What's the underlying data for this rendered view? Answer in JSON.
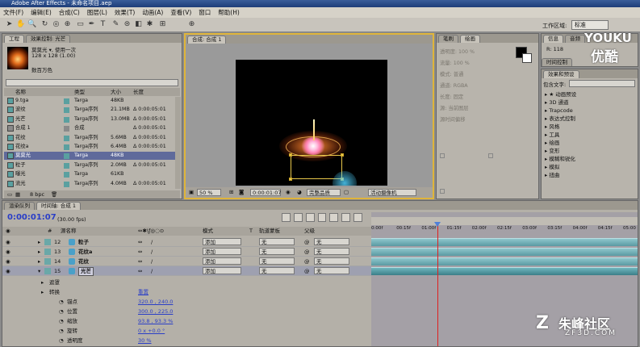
{
  "app": {
    "title": "Adobe After Effects - 未命名项目.aep"
  },
  "menu": [
    "文件(F)",
    "编辑(E)",
    "合成(C)",
    "图层(L)",
    "效果(T)",
    "动画(A)",
    "查看(V)",
    "窗口",
    "帮助(H)"
  ],
  "toolbar": {
    "workspace_label": "工作区域:",
    "workspace_value": "标准"
  },
  "project": {
    "tabs": [
      "工程",
      "效果控制: 光芒"
    ],
    "selected_name": "莫莫光 ▾, 使用一次",
    "selected_size": "128 x 128 (1.00)",
    "selected_color": "数百万色",
    "search_placeholder": "",
    "columns": [
      "名称",
      "类型",
      "大小",
      "长度"
    ],
    "items": [
      {
        "name": "9.tga",
        "type": "Targa",
        "size": "48KB",
        "length": "",
        "color": "#5aa0a0"
      },
      {
        "name": "波纹",
        "type": "Targa序列",
        "size": "21.1MB",
        "length": "Δ 0:00:05:01",
        "color": "#5aa0a0"
      },
      {
        "name": "光芒",
        "type": "Targa序列",
        "size": "13.0MB",
        "length": "Δ 0:00:05:01",
        "color": "#5aa0a0"
      },
      {
        "name": "合成 1",
        "type": "合成",
        "size": "",
        "length": "Δ 0:00:05:01",
        "color": "#8a8a8a"
      },
      {
        "name": "花纹",
        "type": "Targa序列",
        "size": "5.6MB",
        "length": "Δ 0:00:05:01",
        "color": "#5aa0a0"
      },
      {
        "name": "花纹a",
        "type": "Targa序列",
        "size": "6.4MB",
        "length": "Δ 0:00:05:01",
        "color": "#5aa0a0"
      },
      {
        "name": "莫莫光",
        "type": "Targa",
        "size": "48KB",
        "length": "",
        "color": "#5aa0a0",
        "selected": true
      },
      {
        "name": "粒子",
        "type": "Targa序列",
        "size": "2.0MB",
        "length": "Δ 0:00:05:01",
        "color": "#5aa0a0"
      },
      {
        "name": "曝光",
        "type": "Targa",
        "size": "61KB",
        "length": "",
        "color": "#5aa0a0"
      },
      {
        "name": "流光",
        "type": "Targa序列",
        "size": "4.0MB",
        "length": "Δ 0:00:05:01",
        "color": "#5aa0a0"
      }
    ],
    "bpc": "8 bpc"
  },
  "composition": {
    "tab": "合成: 合成 1",
    "zoom": "50 %",
    "timecode": "0:00:01:07",
    "quality": "完整品质",
    "camera": "活动摄像机"
  },
  "info_panels": {
    "tabs_left": [
      "笔刷",
      "绘画"
    ],
    "tabs_right": [
      "信息",
      "音频"
    ],
    "paint_rows": [
      "透明度: 100 %",
      "流量: 100 %",
      "模式: 普通",
      "通道: RGBA",
      "长度: 固定",
      "源: 当前图层",
      "源时间偏移"
    ],
    "info_value": "R: 118",
    "time_control_tab": "时间控制"
  },
  "effects": {
    "tab": "效果和预设",
    "search_label": "包含文字:",
    "items": [
      "▸ ★ 动画预设",
      "▸ 3D 通道",
      "▸ Trapcode",
      "▸ 表达式控制",
      "▸ 风格",
      "▸ 工具",
      "▸ 绘画",
      "▸ 变形",
      "▸ 模糊和锐化",
      "▸ 模拟",
      "▸ 扭曲"
    ]
  },
  "timeline": {
    "tabs": [
      "渲染队列",
      "时间轴: 合成 1"
    ],
    "current_time": "0:00:01:07",
    "fps": "(30.00 fps)",
    "columns": {
      "num": "#",
      "source": "源名称",
      "switches": "模式",
      "t": "T",
      "trkmat": "轨道蒙板",
      "parent": "父级"
    },
    "layers": [
      {
        "num": "12",
        "name": "粒子",
        "mode": "添加",
        "trkmat": "无",
        "parent": "无"
      },
      {
        "num": "13",
        "name": "花纹a",
        "mode": "添加",
        "trkmat": "无",
        "parent": "无"
      },
      {
        "num": "14",
        "name": "花纹",
        "mode": "添加",
        "trkmat": "无",
        "parent": "无"
      },
      {
        "num": "15",
        "name": "光芒",
        "mode": "添加",
        "trkmat": "无",
        "parent": "无"
      }
    ],
    "props": [
      {
        "label": "遮罩",
        "value": "",
        "indent": 1
      },
      {
        "label": "转换",
        "value": "重置",
        "indent": 1
      },
      {
        "label": "锚点",
        "value": "320.0 , 240.0",
        "indent": 2
      },
      {
        "label": "位置",
        "value": "300.0 , 225.0",
        "indent": 2
      },
      {
        "label": "缩放",
        "value": "93.8 , 93.3 %",
        "indent": 2
      },
      {
        "label": "旋转",
        "value": "0 x +0.0 °",
        "indent": 2
      },
      {
        "label": "透明度",
        "value": "30 %",
        "indent": 2
      }
    ],
    "ruler": [
      "0:00f",
      "00:15f",
      "01:00f",
      "01:15f",
      "02:00f",
      "02:15f",
      "03:00f",
      "03:15f",
      "04:00f",
      "04:15f",
      "05:00"
    ]
  },
  "watermarks": {
    "youku_1": "YOUKU",
    "youku_2": "优酷",
    "zf_1": "朱峰社区",
    "zf_2": "ZF3D.COM"
  }
}
